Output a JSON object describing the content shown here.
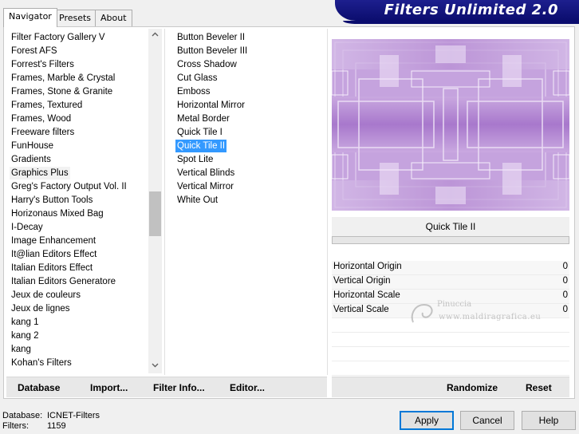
{
  "tabs": [
    {
      "label": "Navigator",
      "active": true
    },
    {
      "label": "Presets",
      "active": false
    },
    {
      "label": "About",
      "active": false
    }
  ],
  "banner": {
    "title": "Filters Unlimited 2.0"
  },
  "categories": {
    "items": [
      "Filter Factory Gallery V",
      "Forest AFS",
      "Forrest's Filters",
      "Frames, Marble & Crystal",
      "Frames, Stone & Granite",
      "Frames, Textured",
      "Frames, Wood",
      "Freeware filters",
      "FunHouse",
      "Gradients",
      "Graphics Plus",
      "Greg's Factory Output Vol. II",
      "Harry's Button Tools",
      "Horizonaus Mixed Bag",
      "I-Decay",
      "Image Enhancement",
      "It@lian Editors Effect",
      "Italian Editors Effect",
      "Italian Editors Generatore",
      "Jeux de couleurs",
      "Jeux de lignes",
      "kang 1",
      "kang 2",
      "kang",
      "Kohan's Filters"
    ],
    "highlighted": "Graphics Plus"
  },
  "filters": {
    "items": [
      "Button Beveler II",
      "Button Beveler III",
      "Cross Shadow",
      "Cut Glass",
      "Emboss",
      "Horizontal Mirror",
      "Metal Border",
      "Quick Tile I",
      "Quick Tile II",
      "Spot Lite",
      "Vertical Blinds",
      "Vertical Mirror",
      "White Out"
    ],
    "selected": "Quick Tile II"
  },
  "current_filter": "Quick Tile II",
  "parameters": [
    {
      "label": "Horizontal Origin",
      "value": "0"
    },
    {
      "label": "Vertical Origin",
      "value": "0"
    },
    {
      "label": "Horizontal Scale",
      "value": "0"
    },
    {
      "label": "Vertical Scale",
      "value": "0"
    }
  ],
  "toolbar": {
    "database": "Database",
    "import": "Import...",
    "filter_info": "Filter Info...",
    "editor": "Editor...",
    "randomize": "Randomize",
    "reset": "Reset"
  },
  "status": {
    "database_label": "Database:",
    "database_value": "ICNET-Filters",
    "filters_label": "Filters:",
    "filters_value": "1159"
  },
  "buttons": {
    "apply": "Apply",
    "cancel": "Cancel",
    "help": "Help"
  },
  "watermark": {
    "name": "Pinuccia",
    "site": "www.maldiragrafica.eu"
  },
  "colors": {
    "banner": "#1d1f8e",
    "selection": "#3399ff",
    "preview_base": "#b88fd4"
  },
  "icons": {
    "scroll_up": "chevron-up-icon",
    "scroll_down": "chevron-down-icon"
  }
}
